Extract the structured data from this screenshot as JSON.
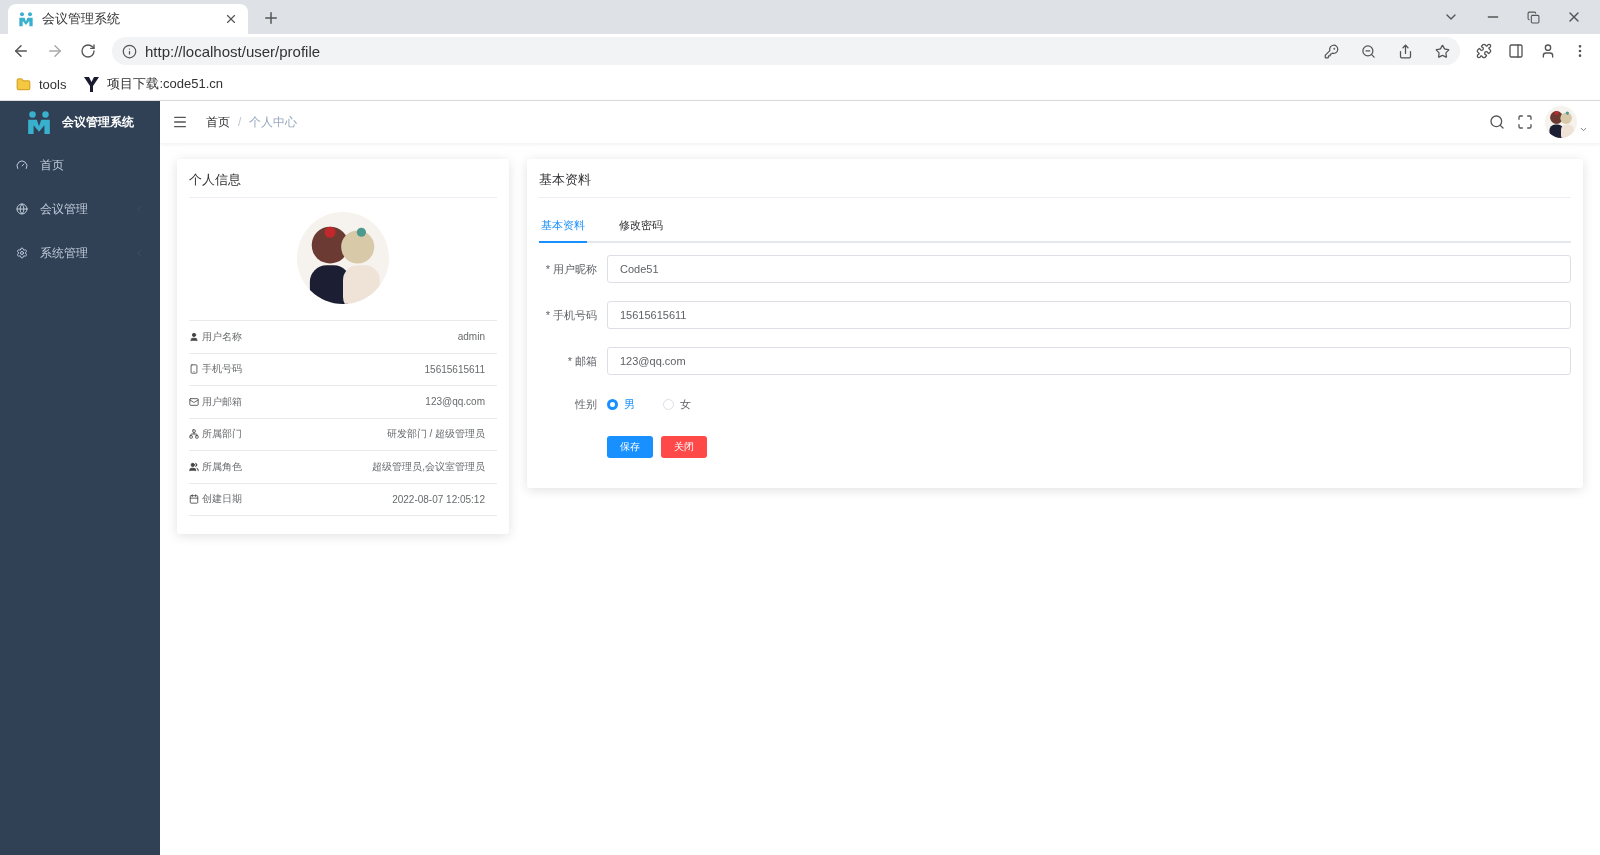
{
  "browser": {
    "tab_title": "会议管理系统",
    "url": "http://localhost/user/profile",
    "bookmarks": [
      {
        "label": "tools",
        "kind": "folder"
      },
      {
        "label": "项目下载:code51.cn",
        "kind": "site"
      }
    ]
  },
  "app": {
    "logo_title": "会议管理系统",
    "sidebar": {
      "items": [
        {
          "label": "首页",
          "kind": "dashboard",
          "expandable": false
        },
        {
          "label": "会议管理",
          "kind": "globe",
          "expandable": true
        },
        {
          "label": "系统管理",
          "kind": "gear",
          "expandable": true
        }
      ]
    },
    "breadcrumb": [
      {
        "label": "首页",
        "current": false
      },
      {
        "label": "个人中心",
        "current": true
      }
    ],
    "breadcrumb_separator": "/",
    "profile_card": {
      "title": "个人信息",
      "rows": [
        {
          "kind": "user",
          "label": "用户名称",
          "value": "admin"
        },
        {
          "kind": "phone",
          "label": "手机号码",
          "value": "15615615611"
        },
        {
          "kind": "mail",
          "label": "用户邮箱",
          "value": "123@qq.com"
        },
        {
          "kind": "tree",
          "label": "所属部门",
          "value": "研发部门 / 超级管理员"
        },
        {
          "kind": "users",
          "label": "所属角色",
          "value": "超级管理员,会议室管理员"
        },
        {
          "kind": "calendar",
          "label": "创建日期",
          "value": "2022-08-07 12:05:12"
        }
      ]
    },
    "form_card": {
      "title": "基本资料",
      "tabs": [
        {
          "label": "基本资料",
          "selected": true
        },
        {
          "label": "修改密码",
          "selected": false
        }
      ],
      "fields": [
        {
          "required_mark": "*",
          "label": "用户昵称",
          "value": "Code51"
        },
        {
          "required_mark": "*",
          "label": "手机号码",
          "value": "15615615611"
        },
        {
          "required_mark": "*",
          "label": "邮箱",
          "value": "123@qq.com"
        }
      ],
      "gender": {
        "label": "性别",
        "options": [
          {
            "label": "男",
            "selected": true
          },
          {
            "label": "女",
            "selected": false
          }
        ]
      },
      "buttons": [
        {
          "label": "保存",
          "kind": "primary"
        },
        {
          "label": "关闭",
          "kind": "danger"
        }
      ]
    }
  }
}
